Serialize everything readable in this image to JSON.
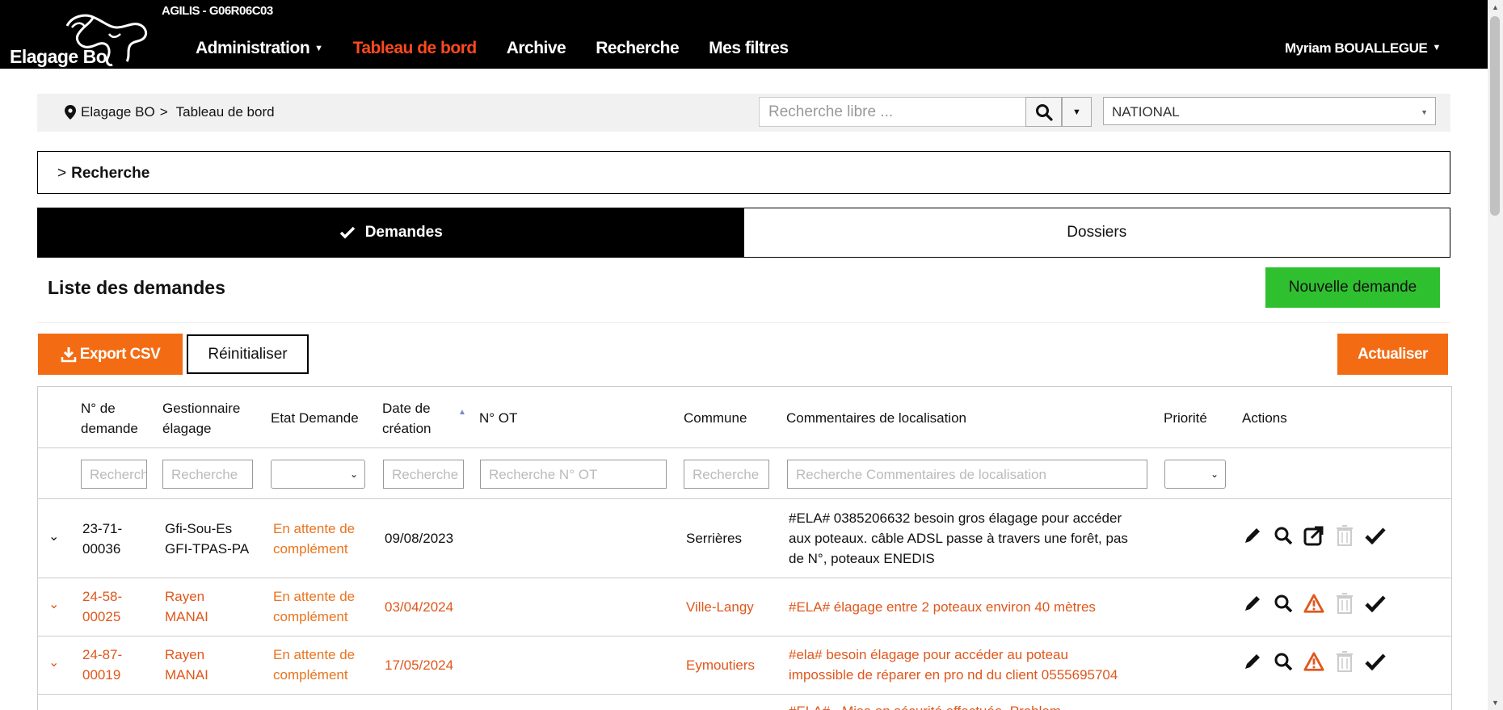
{
  "header": {
    "app_tag": "AGILIS - G06R06C03",
    "logo_text": "Elagage Bo",
    "nav": [
      {
        "label": "Administration",
        "has_caret": true
      },
      {
        "label": "Tableau de bord",
        "active": true
      },
      {
        "label": "Archive"
      },
      {
        "label": "Recherche"
      },
      {
        "label": "Mes filtres"
      }
    ],
    "user": "Myriam BOUALLEGUE",
    "accent_color": "#ff4a1c"
  },
  "breadcrumb": {
    "root": "Elagage BO",
    "separator": ">",
    "current": "Tableau de bord"
  },
  "search": {
    "placeholder": "Recherche libre ...",
    "region": "NATIONAL"
  },
  "recherche_panel": {
    "label": "Recherche"
  },
  "tabs": [
    {
      "label": "Demandes",
      "active": true
    },
    {
      "label": "Dossiers"
    }
  ],
  "list": {
    "title": "Liste des demandes",
    "new_button": "Nouvelle demande",
    "export_button": "Export CSV",
    "reset_button": "Réinitialiser",
    "refresh_button": "Actualiser"
  },
  "table": {
    "columns": [
      "N° de demande",
      "Gestionnaire élagage",
      "Etat Demande",
      "Date de création",
      "N° OT",
      "Commune",
      "Commentaires de localisation",
      "Priorité",
      "Actions"
    ],
    "filters": {
      "num": "Recherche",
      "gest": "Recherche",
      "date": "Recherche",
      "ot": "Recherche N° OT",
      "commune": "Recherche",
      "comment": "Recherche Commentaires de localisation"
    },
    "rows": [
      {
        "num": "23-71-00036",
        "num_l1": "23-71-",
        "num_l2": "00036",
        "gest_l1": "Gfi-Sou-Es",
        "gest_l2": "GFI-TPAS-PA",
        "etat_l1": "En attente de",
        "etat_l2": "complément",
        "date": "09/08/2023",
        "ot": "",
        "commune": "Serrières",
        "comment_l1": "#ELA# 0385206632 besoin gros élagage pour accéder",
        "comment_l2": "aux poteaux. câble ADSL passe à travers une forêt, pas",
        "comment_l3": "de N°, poteaux ENEDIS",
        "highlight": false
      },
      {
        "num_l1": "24-58-",
        "num_l2": "00025",
        "gest_l1": "Rayen",
        "gest_l2": "MANAI",
        "etat_l1": "En attente de",
        "etat_l2": "complément",
        "date": "03/04/2024",
        "ot": "",
        "commune": "Ville-Langy",
        "comment_l1": "#ELA# élagage entre 2 poteaux environ 40 mètres",
        "highlight": true
      },
      {
        "num_l1": "24-87-",
        "num_l2": "00019",
        "gest_l1": "Rayen",
        "gest_l2": "MANAI",
        "etat_l1": "En attente de",
        "etat_l2": "complément",
        "date": "17/05/2024",
        "ot": "",
        "commune": "Eymoutiers",
        "comment_l1": "#ela# besoin élagage pour accéder au poteau",
        "comment_l2": "impossible de réparer en pro nd du client 0555695704",
        "highlight": true
      },
      {
        "comment_l1": "#ELA# - Mise en sécurité effectuée. Problem",
        "highlight": true
      }
    ]
  },
  "colors": {
    "status_orange": "#e9741e",
    "row_orange": "#e0571c",
    "green": "#2fc02f",
    "button_orange": "#f36c13"
  }
}
